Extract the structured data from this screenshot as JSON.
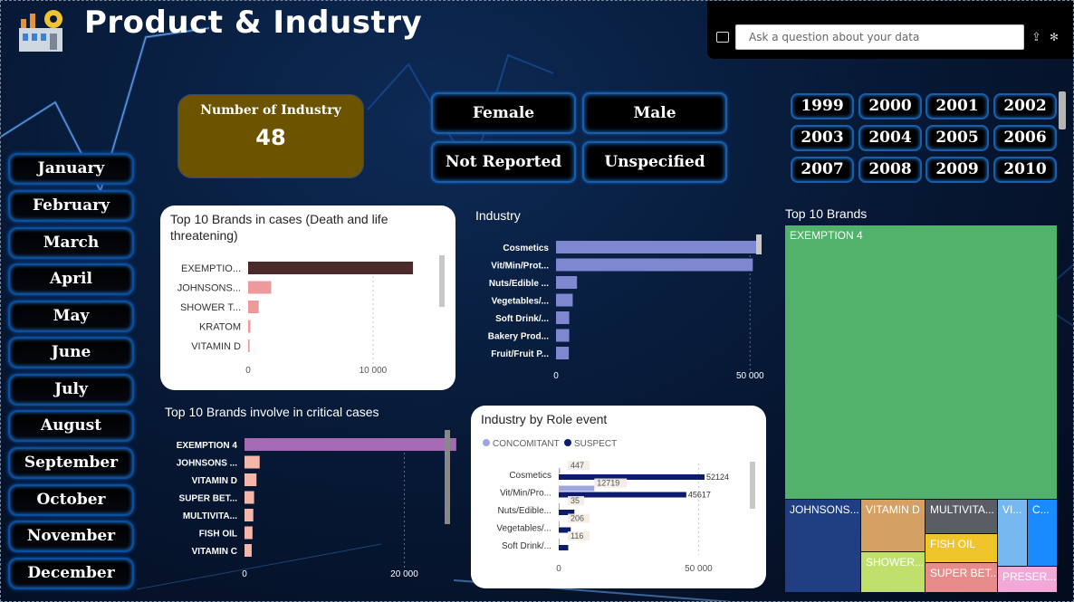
{
  "header": {
    "title": "Product & Industry",
    "qa_placeholder": "Ask a question about your data"
  },
  "months": [
    "January",
    "February",
    "March",
    "April",
    "May",
    "June",
    "July",
    "August",
    "September",
    "October",
    "November",
    "December"
  ],
  "kpi": {
    "label": "Number of Industry",
    "value": "48"
  },
  "gender": [
    "Female",
    "Male",
    "Not Reported",
    "Unspecified"
  ],
  "years": [
    "1999",
    "2000",
    "2001",
    "2002",
    "2003",
    "2004",
    "2005",
    "2006",
    "2007",
    "2008",
    "2009",
    "2010"
  ],
  "colors": {
    "kpi_bg": "#6b5300",
    "button_glow": "#1a5ea8",
    "death_bar_top": "#4a2a2a",
    "death_bar": "#ee9a9c",
    "industry_bar": "#7f87d1",
    "critical_bar_top": "#a66ab5",
    "critical_bar": "#f3b6a8",
    "concomitant": "#9fa6de",
    "suspect": "#0c1b6b"
  },
  "chart_data": [
    {
      "id": "death",
      "type": "bar",
      "orientation": "horizontal",
      "title": "Top 10 Brands in cases (Death and life threatening)",
      "categories": [
        "EXEMPTIO...",
        "JOHNSONS...",
        "SHOWER T...",
        "KRATOM",
        "VITAMIN D"
      ],
      "values": [
        13200,
        1850,
        850,
        180,
        120
      ],
      "xticks": [
        "0",
        "10 000"
      ],
      "xlim": [
        0,
        14500
      ]
    },
    {
      "id": "industry",
      "type": "bar",
      "orientation": "horizontal",
      "title": "Industry",
      "categories": [
        "Cosmetics",
        "Vit/Min/Prot...",
        "Nuts/Edible ...",
        "Vegetables/...",
        "Soft Drink/...",
        "Bakery Prod...",
        "Fruit/Fruit P..."
      ],
      "values": [
        52600,
        50700,
        5400,
        4300,
        3400,
        3400,
        3300
      ],
      "xticks": [
        "0",
        "50 000"
      ],
      "xlim": [
        0,
        63000
      ]
    },
    {
      "id": "critical",
      "type": "bar",
      "orientation": "horizontal",
      "title": "Top 10 Brands involve in critical cases",
      "categories": [
        "EXEMPTION 4",
        "JOHNSONS ...",
        "VITAMIN D",
        "SUPER BET...",
        "MULTIVITA...",
        "FISH OIL",
        "VITAMIN C"
      ],
      "values": [
        26500,
        1900,
        1500,
        1200,
        1100,
        1000,
        900
      ],
      "xticks": [
        "0",
        "20 000"
      ],
      "xlim": [
        0,
        34000
      ]
    },
    {
      "id": "role",
      "type": "bar",
      "orientation": "horizontal",
      "title": "Industry by Role event",
      "categories": [
        "Cosmetics",
        "Vit/Min/Pro...",
        "Nuts/Edible...",
        "Vegetables/...",
        "Soft Drink/..."
      ],
      "series": [
        {
          "name": "CONCOMITANT",
          "values": [
            447,
            12719,
            35,
            206,
            116
          ]
        },
        {
          "name": "SUSPECT",
          "values": [
            52124,
            45617,
            5600,
            4300,
            3400
          ]
        }
      ],
      "value_labels": [
        [
          "447",
          "52124"
        ],
        [
          "12719",
          "45617"
        ],
        [
          "35",
          ""
        ],
        [
          "206",
          ""
        ],
        [
          "116",
          ""
        ]
      ],
      "xticks": [
        "0",
        "50 000"
      ],
      "xlim": [
        0,
        68000
      ]
    },
    {
      "id": "treemap",
      "type": "treemap",
      "title": "Top 10 Brands",
      "items": [
        {
          "label": "EXEMPTION 4",
          "color": "#52b26b"
        },
        {
          "label": "JOHNSONS...",
          "color": "#1f3f82"
        },
        {
          "label": "VITAMIN D",
          "color": "#d4a063"
        },
        {
          "label": "MULTIVITA...",
          "color": "#5a5d63"
        },
        {
          "label": "VI...",
          "color": "#75b9f0"
        },
        {
          "label": "C...",
          "color": "#1a8cff"
        },
        {
          "label": "SHOWER...",
          "color": "#bfe06b"
        },
        {
          "label": "FISH OIL",
          "color": "#f0c52a"
        },
        {
          "label": "SUPER BET...",
          "color": "#e88b8b"
        },
        {
          "label": "PRESER...",
          "color": "#f2a8d8"
        }
      ]
    }
  ]
}
